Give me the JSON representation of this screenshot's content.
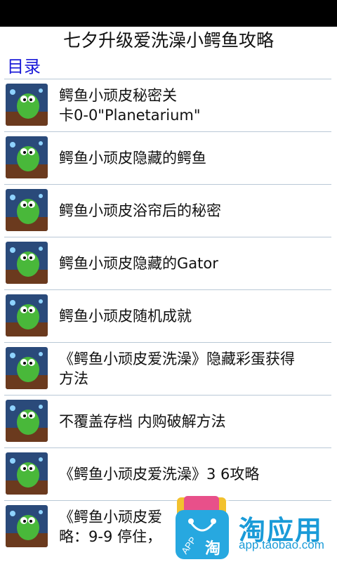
{
  "header": {
    "title": "七夕升级爱洗澡小鳄鱼攻略"
  },
  "section": {
    "label": "目录"
  },
  "items": [
    {
      "title": "鳄鱼小顽皮秘密关卡0-0\"Planetarium\"",
      "line1": "鳄鱼小顽皮秘密关",
      "line2": "卡0-0\"Planetarium\""
    },
    {
      "title": "鳄鱼小顽皮隐藏的鳄鱼"
    },
    {
      "title": "鳄鱼小顽皮浴帘后的秘密"
    },
    {
      "title": "鳄鱼小顽皮隐藏的Gator"
    },
    {
      "title": "鳄鱼小顽皮随机成就"
    },
    {
      "title": "《鳄鱼小顽皮爱洗澡》隐藏彩蛋获得方法",
      "line1": "《鳄鱼小顽皮爱洗澡》隐藏彩蛋获得",
      "line2": "方法"
    },
    {
      "title": "不覆盖存档 内购破解方法"
    },
    {
      "title": "《鳄鱼小顽皮爱洗澡》3 6攻略"
    },
    {
      "title": "《鳄鱼小顽皮爱...",
      "line1": "《鳄鱼小顽皮爱",
      "line2": "略：9-9 停住，"
    }
  ],
  "badge": {
    "name": "淘应用",
    "url": "app.taobao.com",
    "app_label": "APP",
    "bag_char": "淘"
  },
  "colors": {
    "accent": "#1a1ad8",
    "divider": "#b9c8d6",
    "badge": "#1a9bd8"
  }
}
